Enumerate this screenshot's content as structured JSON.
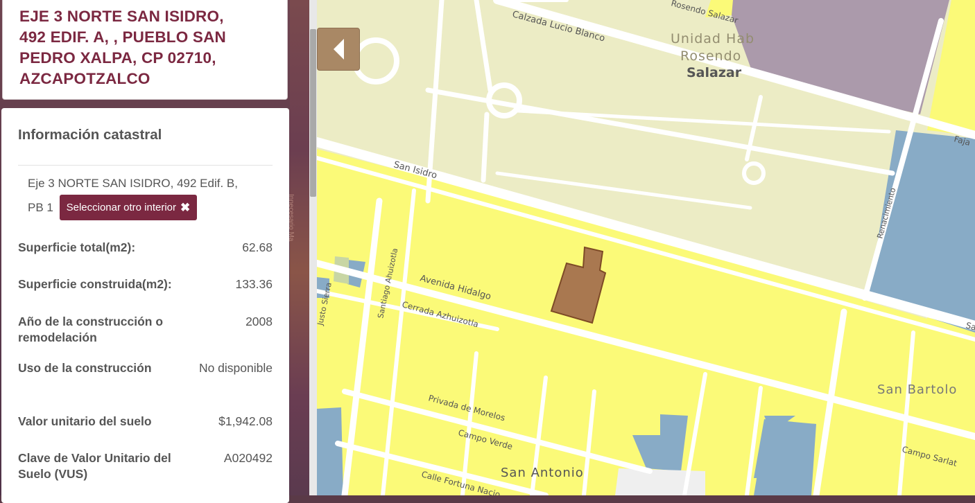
{
  "address": {
    "line1": "EJE 3 NORTE SAN ISIDRO,",
    "line2": "492 EDIF. A, , PUEBLO SAN",
    "line3": "PEDRO XALPA, CP 02710,",
    "line4": "AZCAPOTZALCO"
  },
  "info": {
    "title": "Información catastral",
    "unit_prefix": "Eje 3 NORTE SAN ISIDRO, 492 Edif. B,",
    "unit_suffix": "PB 1",
    "select_button": "Seleccionar otro interior",
    "select_icon": "close-icon",
    "fields": [
      {
        "label": "Superficie total(m2):",
        "value": "62.68"
      },
      {
        "label": "Superficie construida(m2):",
        "value": "133.36"
      },
      {
        "label": "Año de la construcción o remodelación",
        "value": "2008"
      },
      {
        "label": "Uso de la construcción",
        "value": "No disponible"
      },
      {
        "label": "Valor unitario del suelo",
        "value": "$1,942.08"
      },
      {
        "label": "Clave de Valor Unitario del Suelo (VUS)",
        "value": "A020492"
      }
    ]
  },
  "left_side_text": "Innecesario Ma",
  "map": {
    "collapse_icon": "caret-left-icon",
    "colors": {
      "residential": "#fbfa78",
      "park": "#ececc5",
      "block_blue": "#88abc6",
      "purple": "#ab9aab",
      "selected_lot": "#a97850",
      "road": "#ffffff"
    },
    "labels": {
      "calzada": "Calzada Lucio Blanco",
      "rosendo_street": "Rosendo Salazar",
      "unidad1": "Unidad Hab",
      "unidad2": "Rosendo",
      "unidad3": "Salazar",
      "faja": "Faja",
      "san_isidro_top": "San Isidro",
      "san_isidro_right": "San",
      "renacimiento": "Renacimiento",
      "justo_sierra": "Justo Sierra",
      "santiago": "Santiago Ahuizotla",
      "avenida_hidalgo": "Avenida Hidalgo",
      "cerrada": "Cerrada Azhuizotla",
      "privada": "Privada de Morelos",
      "campo_verde": "Campo Verde",
      "campo_sarlat": "Campo Sarlat",
      "calle_fortuna": "Calle Fortuna Nacio",
      "san_antonio": "San Antonio",
      "san_bartolo": "San Bartolo"
    }
  }
}
